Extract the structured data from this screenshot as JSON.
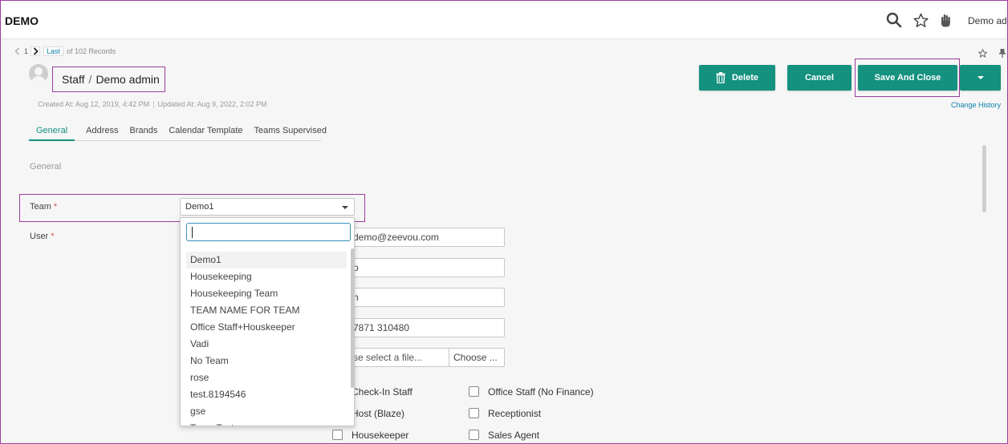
{
  "app": {
    "brand": "DEMO",
    "user": "Demo admin"
  },
  "topbar": {
    "icons": [
      "search-icon",
      "star-icon",
      "hand-icon"
    ]
  },
  "pager": {
    "current": "1",
    "last_label": "Last",
    "records": "of 102 Records"
  },
  "record": {
    "entity": "Staff",
    "separator": "/",
    "name": "Demo admin",
    "created": "Created At: Aug 12, 2019, 4:42 PM",
    "meta_separator": "|",
    "updated": "Updated At: Aug 9, 2022, 2:02 PM"
  },
  "actions": {
    "delete": "Delete",
    "cancel": "Cancel",
    "save_close": "Save And Close",
    "change_history": "Change History"
  },
  "tabs": [
    "General",
    "Address",
    "Brands",
    "Calendar Template",
    "Teams Supervised"
  ],
  "form": {
    "section": "General",
    "team_label": "Team",
    "required_mark": "*",
    "team_value": "Demo1",
    "user_label": "User",
    "fields": [
      "demo@zeevou.com",
      "o",
      "n",
      "7871 310480"
    ],
    "file_placeholder": "se select a file...",
    "file_button": "Choose ..."
  },
  "dropdown": {
    "search_value": "",
    "options": [
      "Demo1",
      "Housekeeping",
      "Housekeeping Team",
      "TEAM NAME FOR TEAM",
      "Office Staff+Houskeeper",
      "Vadi",
      "No Team",
      "rose",
      "test.8194546",
      "gse",
      "Team Test"
    ],
    "highlighted": "Demo1"
  },
  "roles": [
    {
      "label": "Check-In Staff",
      "checked": false
    },
    {
      "label": "Office Staff (No Finance)",
      "checked": false
    },
    {
      "label": "Host (Blaze)",
      "checked": false
    },
    {
      "label": "Receptionist",
      "checked": false
    },
    {
      "label": "Housekeeper",
      "checked": false
    },
    {
      "label": "Sales Agent",
      "checked": false
    }
  ],
  "colors": {
    "accent": "#14917f",
    "link": "#0b7fa6",
    "highlight_outline": "#9c3c9c",
    "required": "#d9534f"
  }
}
